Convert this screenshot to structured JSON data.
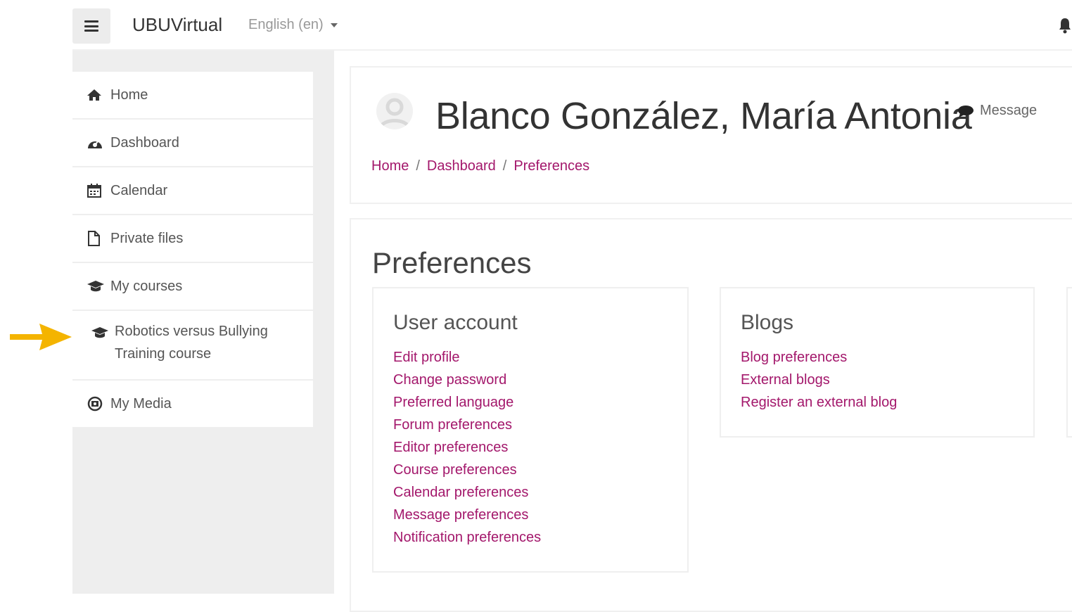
{
  "navbar": {
    "brand": "UBUVirtual",
    "language": "English (en)"
  },
  "sidebar": {
    "items": [
      {
        "label": "Home",
        "icon": "home-icon"
      },
      {
        "label": "Dashboard",
        "icon": "dashboard-icon"
      },
      {
        "label": "Calendar",
        "icon": "calendar-icon"
      },
      {
        "label": "Private files",
        "icon": "file-icon"
      },
      {
        "label": "My courses",
        "icon": "graduation-cap-icon"
      },
      {
        "label": "Robotics versus Bullying Training course",
        "icon": "graduation-cap-icon"
      },
      {
        "label": "My Media",
        "icon": "media-icon"
      }
    ]
  },
  "header": {
    "user_name": "Blanco González, María Antonia",
    "message_label": "Message",
    "breadcrumb": [
      "Home",
      "Dashboard",
      "Preferences"
    ],
    "breadcrumb_separator": "/"
  },
  "main": {
    "title": "Preferences",
    "user_account": {
      "heading": "User account",
      "links": [
        "Edit profile",
        "Change password",
        "Preferred language",
        "Forum preferences",
        "Editor preferences",
        "Course preferences",
        "Calendar preferences",
        "Message preferences",
        "Notification preferences"
      ]
    },
    "blogs": {
      "heading": "Blogs",
      "links": [
        "Blog preferences",
        "External blogs",
        "Register an external blog"
      ]
    }
  },
  "colors": {
    "link": "#a3176b",
    "drawer_bg": "#eeeeee",
    "arrow": "#f4b400"
  }
}
